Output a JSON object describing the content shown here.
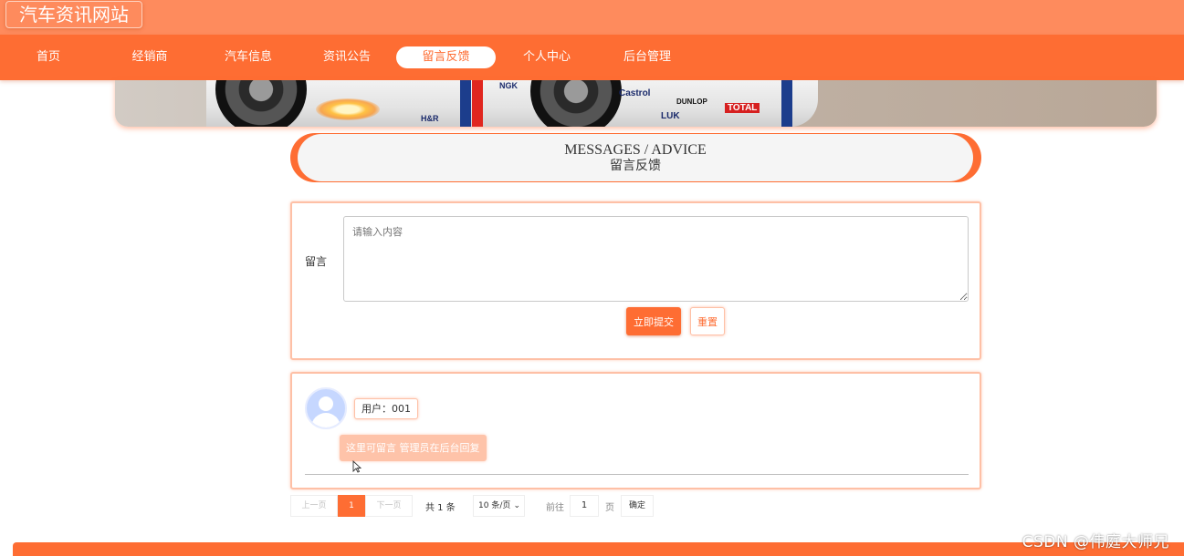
{
  "header": {
    "site_title": "汽车资讯网站"
  },
  "nav": {
    "items": [
      {
        "label": "首页"
      },
      {
        "label": "经销商"
      },
      {
        "label": "汽车信息"
      },
      {
        "label": "资讯公告"
      },
      {
        "label": "留言反馈",
        "active": true
      },
      {
        "label": "个人中心"
      },
      {
        "label": "后台管理"
      }
    ]
  },
  "banner": {
    "decals": [
      "Castrol",
      "DUNLOP",
      "TOTAL",
      "LUK",
      "H&R",
      "NGK"
    ]
  },
  "section": {
    "title_en": "MESSAGES / ADVICE",
    "title_zh": "留言反馈"
  },
  "form": {
    "label": "留言",
    "placeholder": "请输入内容",
    "submit_label": "立即提交",
    "reset_label": "重置"
  },
  "messages": [
    {
      "user": "用户：001",
      "content": "这里可留言 管理员在后台回复"
    }
  ],
  "pagination": {
    "prev_label": "上一页",
    "current_page": "1",
    "next_label": "下一页",
    "total": "共 1 条",
    "page_size": "10 条/页",
    "goto_label": "前往",
    "goto_value": "1",
    "page_suffix": "页",
    "confirm_label": "确定"
  },
  "watermark": "CSDN @伟庭大师兄",
  "colors": {
    "primary": "#fe6d33",
    "header": "#fe8b5d",
    "border": "#fec0a6"
  }
}
